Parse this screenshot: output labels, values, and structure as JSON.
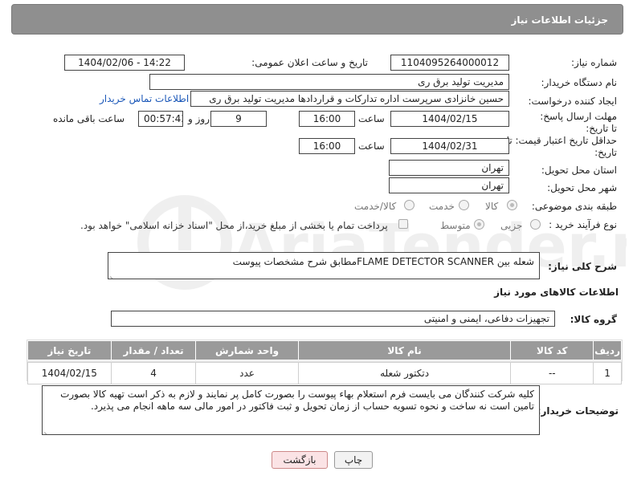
{
  "header": {
    "title": "جزئیات اطلاعات نیاز"
  },
  "form": {
    "need_number_label": "شماره نیاز:",
    "need_number": "1104095264000012",
    "announce_label": "تاریخ و ساعت اعلان عمومی:",
    "announce_value": "1404/02/06 - 14:22",
    "buyer_org_label": "نام دستگاه خریدار:",
    "buyer_org": "مدیریت تولید برق ری",
    "creator_label": "ایجاد کننده درخواست:",
    "creator": "حسین خانزادی سرپرست اداره تدارکات و قراردادها مدیریت تولید برق ری",
    "contact_link": "اطلاعات تماس خریدار",
    "deadline_label": "مهلت ارسال پاسخ: تا تاریخ:",
    "deadline_date": "1404/02/15",
    "time_label": "ساعت",
    "deadline_time": "16:00",
    "days_value": "9",
    "days_label": "روز و",
    "remaining_time": "00:57:43",
    "remaining_label": "ساعت باقی مانده",
    "price_valid_label": "حداقل تاریخ اعتبار قیمت: تا تاریخ:",
    "price_valid_date": "1404/02/31",
    "price_valid_time": "16:00",
    "province_label": "استان محل تحویل:",
    "province": "تهران",
    "city_label": "شهر محل تحویل:",
    "city": "تهران",
    "category_label": "طبقه بندی موضوعی:",
    "category_options": [
      "کالا",
      "خدمت",
      "کالا/خدمت"
    ],
    "process_label": "نوع فرآیند خرید :",
    "process_options": [
      "جزیی",
      "متوسط"
    ],
    "payment_note": "پرداخت تمام یا بخشی از مبلغ خرید،از محل \"اسناد خزانه اسلامی\" خواهد بود.",
    "description_label": "شرح کلی نیاز:",
    "description": "شعله بین FLAME DETECTOR SCANNERمطابق شرح مشخصات پیوست"
  },
  "goods": {
    "section_title": "اطلاعات کالاهای مورد نیاز",
    "group_label": "گروه کالا:",
    "group_value": "تجهیزات دفاعی، ایمنی و امنیتی",
    "columns": [
      "ردیف",
      "کد کالا",
      "نام کالا",
      "واحد شمارش",
      "تعداد / مقدار",
      "تاریخ نیاز"
    ],
    "rows": [
      [
        "1",
        "--",
        "دتکتور شعله",
        "عدد",
        "4",
        "1404/02/15"
      ]
    ]
  },
  "buyer_notes": {
    "label": "توضیحات خریدار:",
    "text": "کلیه شرکت کنندگان می بایست فرم استعلام بهاء پیوست را بصورت کامل پر نمایند و لازم به ذکر است تهیه کالا بصورت تامین است نه ساخت و نحوه تسویه حساب از زمان تحویل و ثبت فاکتور در امور مالی سه ماهه انجام می پذیرد."
  },
  "buttons": {
    "print": "چاپ",
    "back": "بازگشت"
  },
  "watermark": {
    "text": "AriaTender.neT"
  }
}
